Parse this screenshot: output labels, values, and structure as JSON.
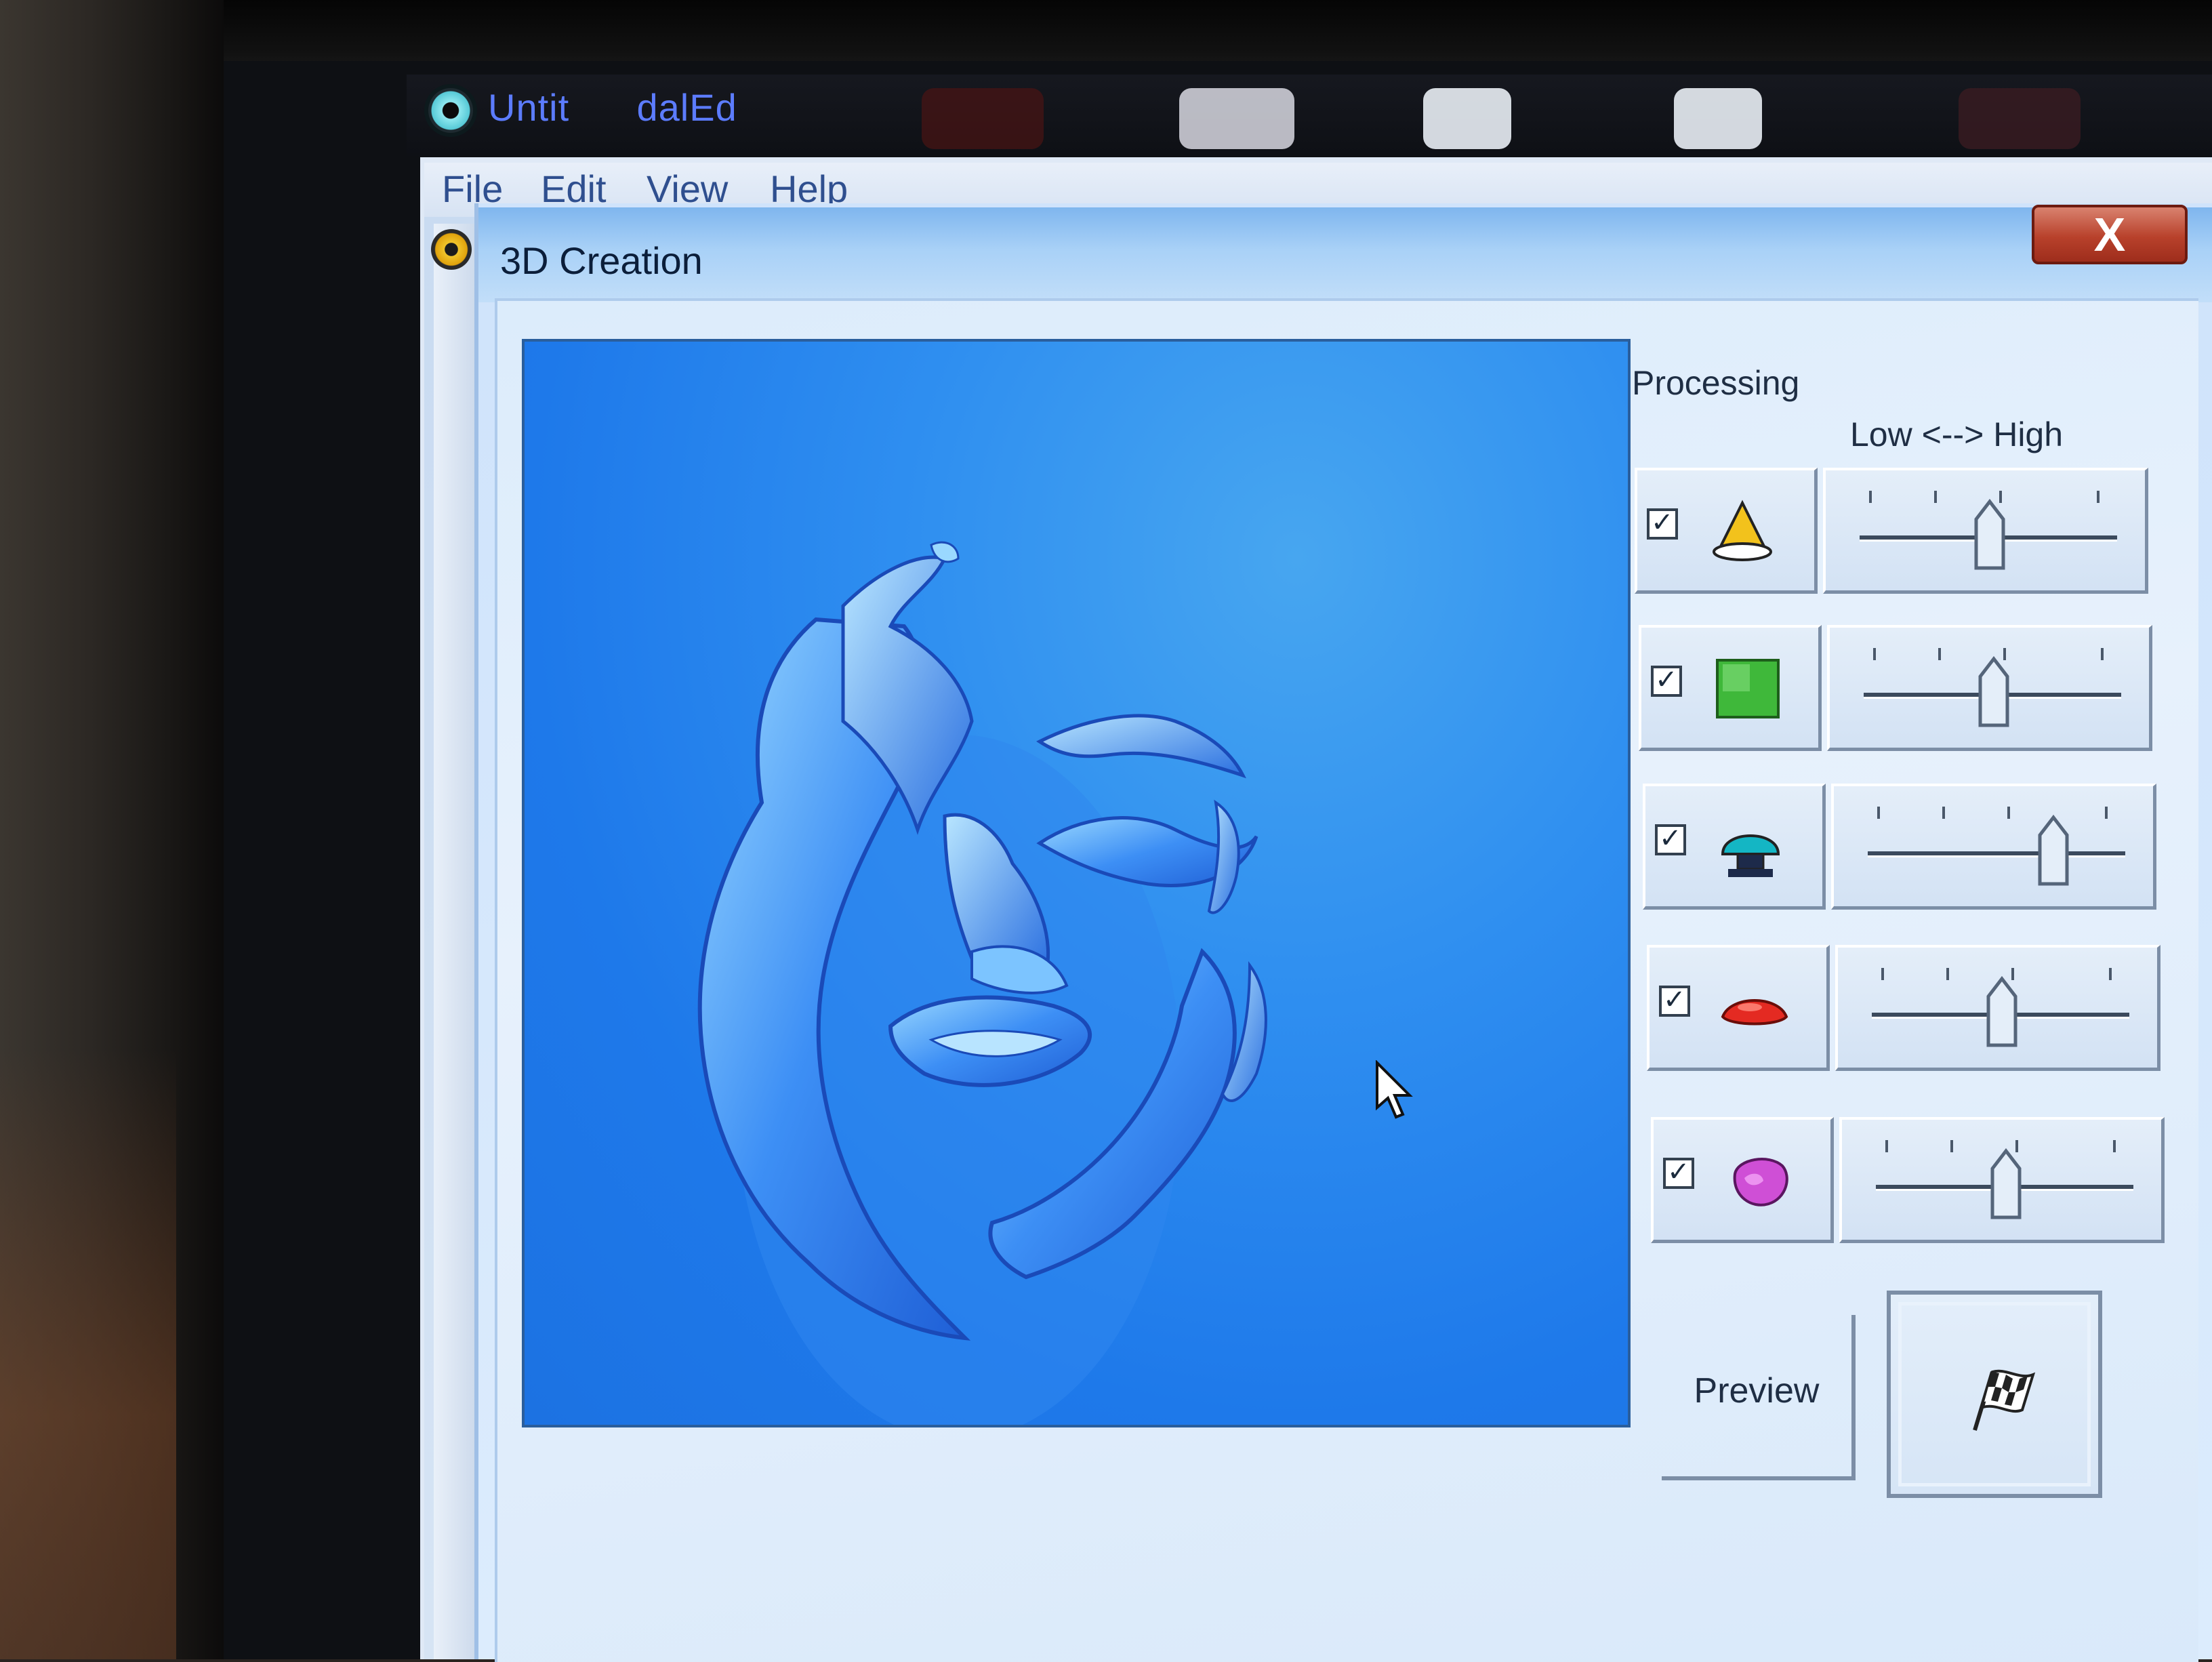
{
  "window": {
    "app_title_visible": "Untit      dalEd"
  },
  "menu": {
    "items": [
      "File",
      "Edit",
      "View",
      "Help"
    ]
  },
  "dialog": {
    "title": "3D Creation",
    "close_glyph": "X"
  },
  "processing": {
    "label": "Processing",
    "range_label": "Low <--> High",
    "rows": [
      {
        "icon": "cone-icon",
        "checked": true,
        "level": 0.5
      },
      {
        "icon": "texture-icon",
        "checked": true,
        "level": 0.5
      },
      {
        "icon": "dome-icon",
        "checked": true,
        "level": 0.75
      },
      {
        "icon": "lens-icon",
        "checked": true,
        "level": 0.5
      },
      {
        "icon": "blob-icon",
        "checked": true,
        "level": 0.5
      }
    ],
    "check_glyph": "✓"
  },
  "buttons": {
    "preview_label": "Preview",
    "finish_icon": "checkered-flag-icon"
  },
  "colors": {
    "canvas_blue": "#2f8ff0",
    "close_red": "#b8412b",
    "title_text": "#0b1e3a"
  }
}
